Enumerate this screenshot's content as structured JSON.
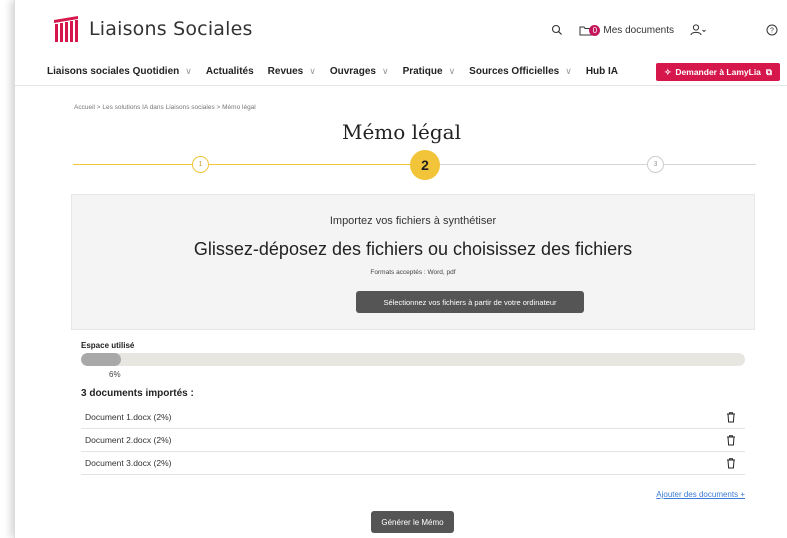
{
  "header": {
    "brand": "Liaisons Sociales",
    "search_icon": "search-icon",
    "my_documents_count": "0",
    "my_documents_label": "Mes documents",
    "user_icon": "user-icon",
    "help_icon": "help-icon"
  },
  "nav": {
    "items": [
      {
        "label": "Liaisons sociales Quotidien",
        "has_dropdown": true
      },
      {
        "label": "Actualités",
        "has_dropdown": false
      },
      {
        "label": "Revues",
        "has_dropdown": true
      },
      {
        "label": "Ouvrages",
        "has_dropdown": true
      },
      {
        "label": "Pratique",
        "has_dropdown": true
      },
      {
        "label": "Sources Officielles",
        "has_dropdown": true
      },
      {
        "label": "Hub IA",
        "has_dropdown": false
      }
    ],
    "cta_label": "Demander à LamyLia",
    "cta_color": "#d6174b"
  },
  "breadcrumb": "Accueil > Les solutions IA dans Liaisons sociales > Mémo légal",
  "page_title": "Mémo légal",
  "stepper": {
    "steps": [
      "1",
      "2",
      "3"
    ],
    "active": "2",
    "accent": "#f2c43a"
  },
  "upload": {
    "subtitle": "Importez vos fichiers à synthétiser",
    "main_text": "Glissez-déposez des fichiers ou choisissez des fichiers",
    "formats": "Formats acceptés : Word, pdf",
    "button_label": "Sélectionnez vos fichiers à partir de votre ordinateur"
  },
  "usage": {
    "label": "Espace utilisé",
    "percent_text": "6%",
    "fraction": 0.06
  },
  "documents": {
    "title": "3 documents importés :",
    "items": [
      "Document 1.docx (2%)",
      "Document 2.docx (2%)",
      "Document 3.docx (2%)"
    ]
  },
  "add_documents_label": "Ajouter des documents +",
  "generate_label": "Générer le Mémo"
}
